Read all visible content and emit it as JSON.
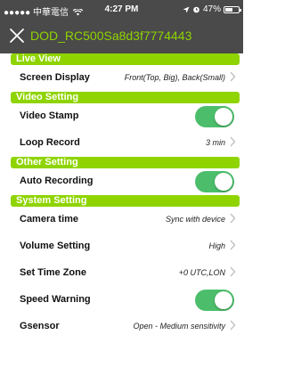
{
  "status_bar": {
    "carrier": "●●●●● 中華電信",
    "wifi_icon": "wifi-icon",
    "time": "4:27 PM",
    "location_icon": "location-arrow-icon",
    "alarm_icon": "alarm-icon",
    "battery_text": "47%",
    "battery_level": 0.47
  },
  "nav": {
    "close_icon": "close-icon",
    "title": "DOD_RC500Sa8d3f7774443",
    "page_count": 2,
    "active_page": 0
  },
  "colors": {
    "accent": "#8fd400",
    "bar": "#4a4a4a",
    "toggle_on": "#4cbe6b"
  },
  "sections": {
    "live_view": {
      "title": "Live View",
      "screen_display": {
        "label": "Screen Display",
        "value": "Front(Top, Big), Back(Small)"
      }
    },
    "video_setting": {
      "title": "Video Setting",
      "video_stamp": {
        "label": "Video Stamp",
        "on": true
      },
      "loop_record": {
        "label": "Loop Record",
        "value": "3 min"
      }
    },
    "other_setting": {
      "title": "Other Setting",
      "auto_recording": {
        "label": "Auto Recording",
        "on": true
      }
    },
    "system_setting": {
      "title": "System Setting",
      "camera_time": {
        "label": "Camera time",
        "value": "Sync with device"
      },
      "volume_setting": {
        "label": "Volume Setting",
        "value": "High"
      },
      "set_time_zone": {
        "label": "Set Time Zone",
        "value": "+0 UTC,LON"
      },
      "speed_warning": {
        "label": "Speed Warning",
        "on": true
      },
      "gsensor": {
        "label": "Gsensor",
        "value": "Open - Medium sensitivity"
      }
    }
  }
}
